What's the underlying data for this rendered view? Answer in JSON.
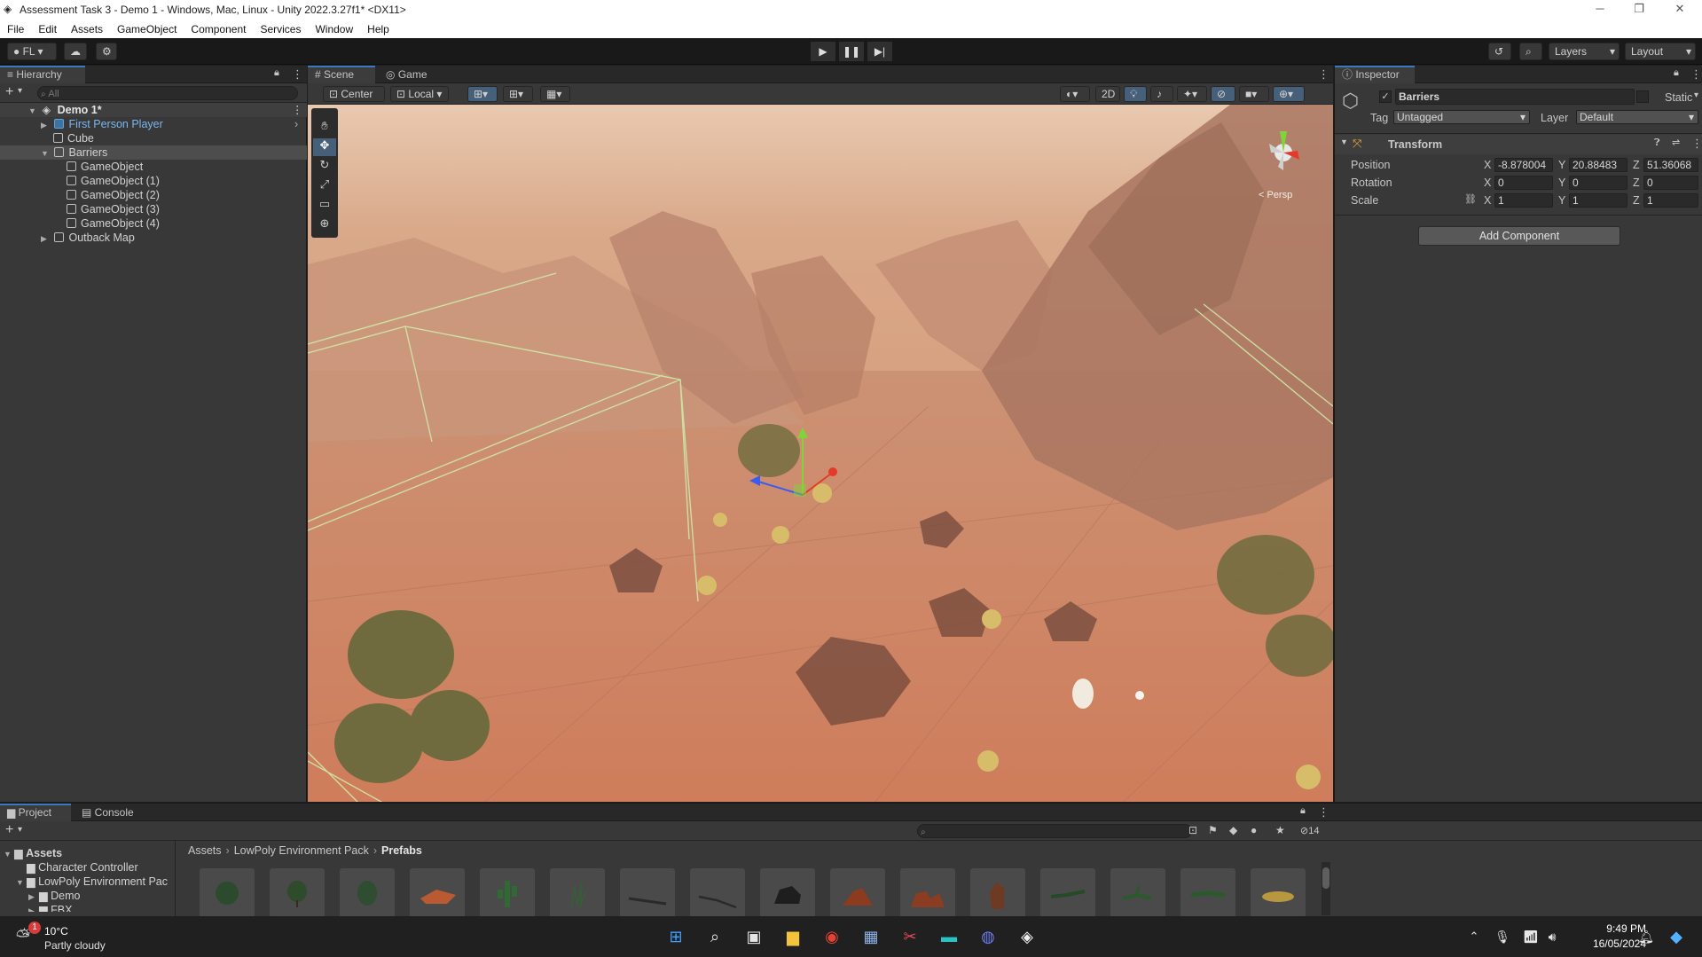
{
  "window": {
    "title": "Assessment Task 3 - Demo 1 - Windows, Mac, Linux - Unity 2022.3.27f1* <DX11>",
    "controls": {
      "minimize": "─",
      "maximize": "❐",
      "close": "✕"
    }
  },
  "menu": [
    "File",
    "Edit",
    "Assets",
    "GameObject",
    "Component",
    "Services",
    "Window",
    "Help"
  ],
  "toolbar": {
    "account": "FL",
    "layers": "Layers",
    "layout": "Layout"
  },
  "hierarchy": {
    "tab": "Hierarchy",
    "search_placeholder": "All",
    "scene": "Demo 1*",
    "items": [
      {
        "label": "First Person Player",
        "depth": 1,
        "expandable": true,
        "prefab": true
      },
      {
        "label": "Cube",
        "depth": 1,
        "expandable": false,
        "prefab": false
      },
      {
        "label": "Barriers",
        "depth": 1,
        "expandable": true,
        "expanded": true,
        "selected": true
      },
      {
        "label": "GameObject",
        "depth": 2
      },
      {
        "label": "GameObject (1)",
        "depth": 2
      },
      {
        "label": "GameObject (2)",
        "depth": 2
      },
      {
        "label": "GameObject (3)",
        "depth": 2
      },
      {
        "label": "GameObject (4)",
        "depth": 2
      },
      {
        "label": "Outback Map",
        "depth": 1,
        "expandable": true
      }
    ]
  },
  "scene_view": {
    "tabs": [
      "Scene",
      "Game"
    ],
    "active_tab": "Scene",
    "pivot": "Center",
    "space": "Local",
    "mode_2d": "2D",
    "persp_label": "< Persp"
  },
  "inspector": {
    "tab": "Inspector",
    "object_name": "Barriers",
    "static_label": "Static",
    "tag_label": "Tag",
    "tag_value": "Untagged",
    "layer_label": "Layer",
    "layer_value": "Default",
    "component": "Transform",
    "position_label": "Position",
    "rotation_label": "Rotation",
    "scale_label": "Scale",
    "position": {
      "x": "-8.878004",
      "y": "20.88483",
      "z": "51.36068"
    },
    "rotation": {
      "x": "0",
      "y": "0",
      "z": "0"
    },
    "scale": {
      "x": "1",
      "y": "1",
      "z": "1"
    },
    "add_component": "Add Component"
  },
  "project": {
    "tabs": [
      "Project",
      "Console"
    ],
    "tree": [
      "Assets",
      "Character Controller",
      "LowPoly Environment Pac",
      "Demo",
      "FBX"
    ],
    "breadcrumb": [
      "Assets",
      "LowPoly Environment Pack",
      "Prefabs"
    ],
    "hidden_count": "14",
    "assets_count": 16
  },
  "taskbar": {
    "weather_temp": "10°C",
    "weather_desc": "Partly cloudy",
    "weather_badge": "1",
    "time": "9:49 PM",
    "date": "16/05/2024"
  },
  "colors": {
    "accent_blue": "#3a79bb",
    "desert": "#c98b6a",
    "selection": "#4d4d4d"
  }
}
